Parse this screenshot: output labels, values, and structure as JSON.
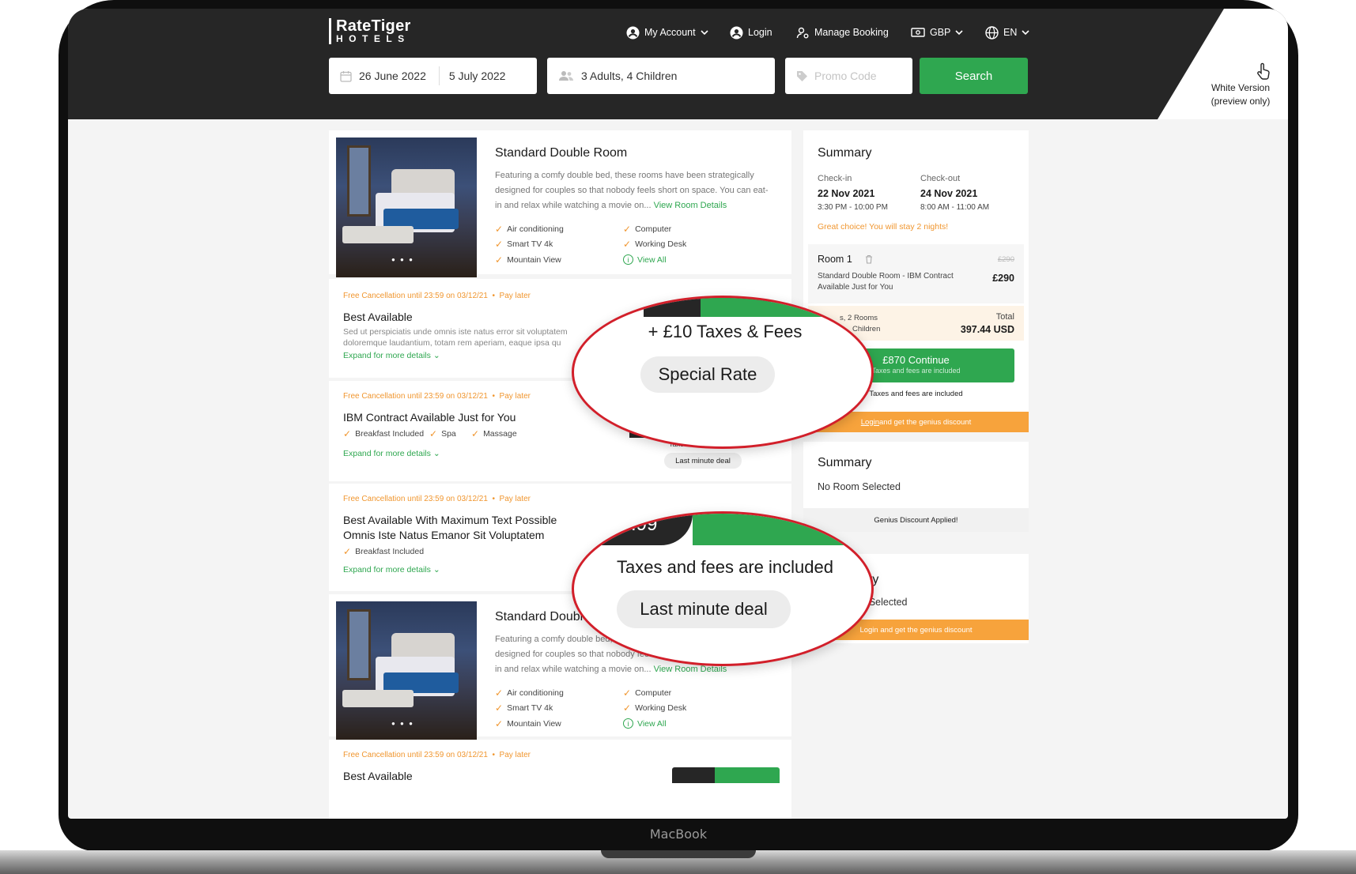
{
  "device": {
    "brand": "MacBook"
  },
  "header": {
    "logo_top": "RateTiger",
    "logo_bottom": "HOTELS",
    "nav": {
      "account": "My Account",
      "login": "Login",
      "manage": "Manage Booking",
      "currency": "GBP",
      "language": "EN"
    },
    "search": {
      "checkin": "26 June 2022",
      "checkout": "5 July 2022",
      "guests": "3 Adults, 4 Children",
      "promo_placeholder": "Promo Code",
      "button": "Search"
    },
    "white_version": {
      "line1": "White Version",
      "line2": "(preview only)"
    }
  },
  "rooms": [
    {
      "title": "Standard Double Room",
      "desc": "Featuring a comfy double bed, these rooms have been strategically designed for couples so that nobody feels short on space. You can eat-in and relax while watching a movie on... ",
      "link": "View Room Details",
      "amenities": [
        "Air conditioning",
        "Computer",
        "Smart TV 4k",
        "Working Desk",
        "Mountain View",
        "View All"
      ]
    },
    {
      "title": "Standard Double R",
      "desc": "Featuring a comfy double bed, these rooms",
      "desc_tail": "designed for couples so that nobody feels short on space. You can eat-in and relax while watching a movie on... ",
      "link": "View Room Details",
      "amenities": [
        "Air conditioning",
        "Computer",
        "Smart TV 4k",
        "Working Desk",
        "Mountain View",
        "View All"
      ]
    }
  ],
  "rates": [
    {
      "cancel": "Free Cancellation until 23:59 on 03/12/21",
      "pay": "Pay later",
      "title": "Best Available",
      "desc": "Sed ut perspiciatis unde omnis iste natus error sit voluptatem doloremque laudantium, totam rem aperiam, eaque ipsa qu",
      "expand": "Expand for more details"
    },
    {
      "cancel": "Free Cancellation until 23:59 on 03/12/21",
      "pay": "Pay later",
      "title": "IBM Contract Available Just for You",
      "features": [
        "Breakfast Included",
        "Spa",
        "Massage"
      ],
      "expand": "Expand for more details",
      "taxes_note": "Taxes and fees are included",
      "badge": "Last minute deal"
    },
    {
      "cancel": "Free Cancellation until 23:59 on 03/12/21",
      "pay": "Pay later",
      "title_line1": "Best Available With Maximum Text Possible",
      "title_line2": "Omnis Iste Natus Emanor Sit Voluptatem",
      "features": [
        "Breakfast Included"
      ],
      "expand": "Expand for more details"
    },
    {
      "cancel": "Free Cancellation until 23:59 on 03/12/21",
      "pay": "Pay later",
      "title": "Best Available"
    }
  ],
  "summary": {
    "title": "Summary",
    "checkin_label": "Check-in",
    "checkin_date": "22 Nov 2021",
    "checkin_time": "3:30 PM - 10:00 PM",
    "checkout_label": "Check-out",
    "checkout_date": "24 Nov 2021",
    "checkout_time": "8:00 AM - 11:00 AM",
    "stay_note": "Great choice! You will stay 2 nights!",
    "room_label": "Room 1",
    "room_old_price": "£290",
    "room_desc_line1": "Standard Double Room - IBM Contract",
    "room_desc_line2": "Available Just for You",
    "room_price": "£290",
    "guests_line1": "s, 2 Rooms",
    "guests_line2": "Children",
    "total_label": "Total",
    "total_value": "397.44 USD",
    "continue_label": "£870 Continue",
    "continue_sub": "Taxes and fees are included",
    "taxes_note": "Taxes and fees are included",
    "login_link": "Login",
    "login_rest": " and get the genius discount"
  },
  "summary2": {
    "title": "Summary",
    "no_room": "No Room Selected",
    "genius": "Genius Discount Applied!"
  },
  "summary3": {
    "title_fragment": "ry",
    "no_room_fragment": "om Selected",
    "login_bar": "Login and get the genius discount"
  },
  "zoom1": {
    "taxes": "+ £10 Taxes & Fees",
    "badge": "Special Rate"
  },
  "zoom2": {
    "price_fragment": ".99",
    "taxes": "Taxes and fees are included",
    "badge": "Last minute deal"
  },
  "colors": {
    "green": "#2fa750",
    "orange": "#f0962f",
    "dark": "#262626",
    "callout": "#d21f2a"
  }
}
